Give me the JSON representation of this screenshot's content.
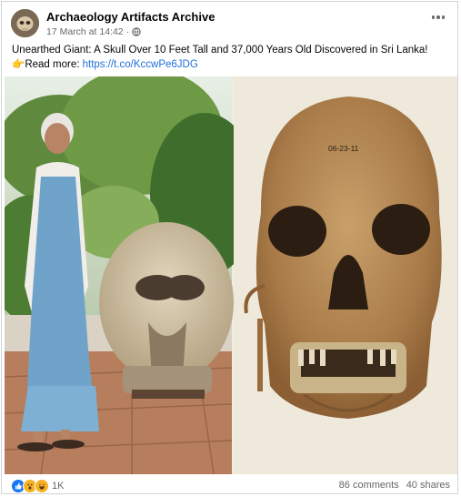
{
  "post": {
    "page_name": "Archaeology Artifacts Archive",
    "timestamp": "17 March at 14:42",
    "separator": "·",
    "audience_icon": "globe-icon",
    "caption_line1": "Unearthed Giant: A Skull Over 10 Feet Tall and 37,000 Years Old Discovered in Sri Lanka!",
    "read_more_emoji": "👉",
    "read_more_label": "Read more: ",
    "link": "https://t.co/KccwPe6JDG"
  },
  "photo": {
    "skull_label": "06-23-11"
  },
  "engagement": {
    "reaction_icons": [
      "like-icon",
      "wow-icon",
      "haha-icon"
    ],
    "reaction_count": "1K",
    "comments": "86 comments",
    "shares": "40 shares"
  },
  "colors": {
    "link": "#216fdb",
    "like": "#1877f2",
    "reaction_yellow": "#f7b125"
  }
}
